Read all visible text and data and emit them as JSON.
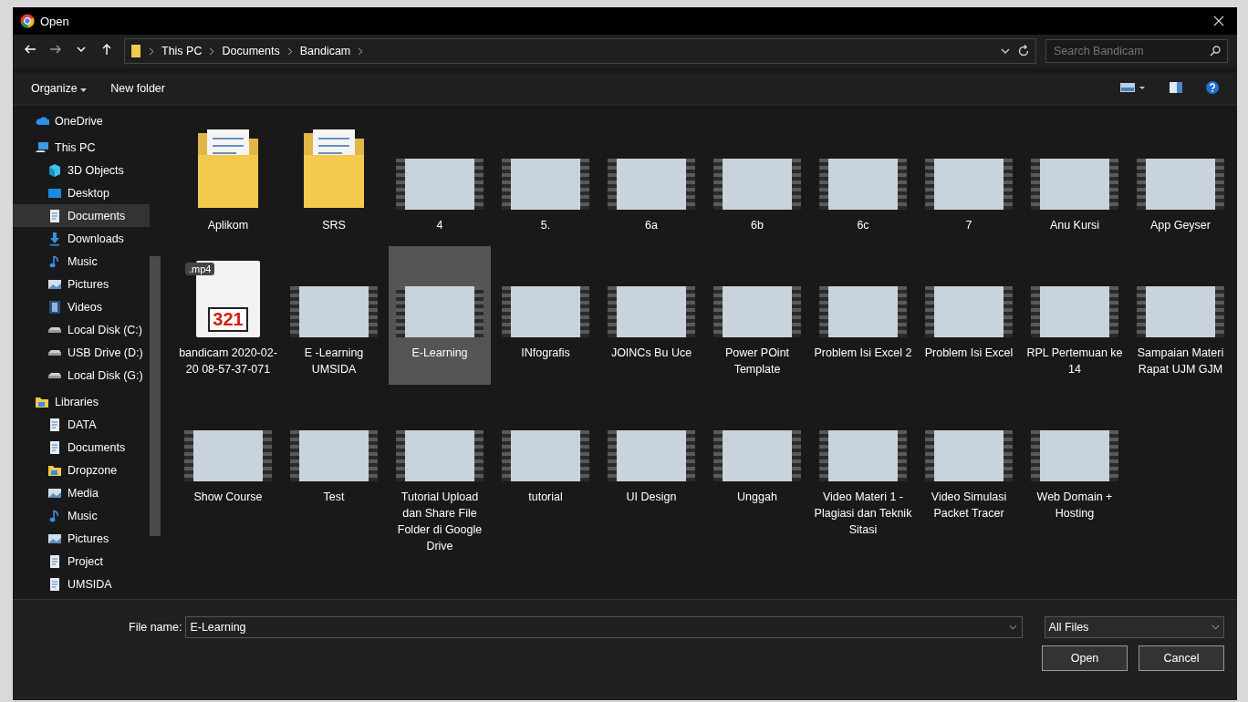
{
  "window": {
    "title": "Open"
  },
  "address": {
    "path": [
      "This PC",
      "Documents",
      "Bandicam"
    ],
    "search_placeholder": "Search Bandicam"
  },
  "toolbar": {
    "organize": "Organize",
    "new_folder": "New folder"
  },
  "sidebar": {
    "items": [
      {
        "label": "OneDrive",
        "selected": false
      },
      {
        "label": "This PC",
        "selected": false,
        "children": [
          {
            "label": "3D Objects",
            "selected": false
          },
          {
            "label": "Desktop",
            "selected": false
          },
          {
            "label": "Documents",
            "selected": true
          },
          {
            "label": "Downloads",
            "selected": false
          },
          {
            "label": "Music",
            "selected": false
          },
          {
            "label": "Pictures",
            "selected": false
          },
          {
            "label": "Videos",
            "selected": false
          },
          {
            "label": "Local Disk (C:)",
            "selected": false
          },
          {
            "label": "USB Drive (D:)",
            "selected": false
          },
          {
            "label": "Local Disk (G:)",
            "selected": false
          }
        ]
      },
      {
        "label": "Libraries",
        "selected": false,
        "children": [
          {
            "label": "DATA",
            "selected": false
          },
          {
            "label": "Documents",
            "selected": false
          },
          {
            "label": "Dropzone",
            "selected": false
          },
          {
            "label": "Media",
            "selected": false
          },
          {
            "label": "Music",
            "selected": false
          },
          {
            "label": "Pictures",
            "selected": false
          },
          {
            "label": "Project",
            "selected": false
          },
          {
            "label": "UMSIDA",
            "selected": false
          }
        ]
      }
    ]
  },
  "files": [
    {
      "name": "Aplikom",
      "kind": "folder",
      "selected": false
    },
    {
      "name": "SRS",
      "kind": "folder",
      "selected": false
    },
    {
      "name": "4",
      "kind": "video",
      "selected": false
    },
    {
      "name": "5.",
      "kind": "video",
      "selected": false
    },
    {
      "name": "6a",
      "kind": "video",
      "selected": false
    },
    {
      "name": "6b",
      "kind": "video",
      "selected": false
    },
    {
      "name": "6c",
      "kind": "video",
      "selected": false
    },
    {
      "name": "7",
      "kind": "video",
      "selected": false
    },
    {
      "name": "Anu Kursi",
      "kind": "video",
      "selected": false
    },
    {
      "name": "App Geyser",
      "kind": "video",
      "selected": false
    },
    {
      "name": "bandicam 2020-02-20 08-57-37-071",
      "kind": "mp4",
      "badge": ".mp4",
      "icon_text": "321",
      "selected": false
    },
    {
      "name": "E -Learning UMSIDA",
      "kind": "video",
      "selected": false
    },
    {
      "name": "E-Learning",
      "kind": "video",
      "selected": true
    },
    {
      "name": "INfografis",
      "kind": "video",
      "selected": false
    },
    {
      "name": "JOINCs Bu Uce",
      "kind": "video",
      "selected": false
    },
    {
      "name": "Power POint Template",
      "kind": "video",
      "selected": false
    },
    {
      "name": "Problem Isi Excel 2",
      "kind": "video",
      "selected": false
    },
    {
      "name": "Problem Isi Excel",
      "kind": "video",
      "selected": false
    },
    {
      "name": "RPL Pertemuan ke 14",
      "kind": "video",
      "selected": false
    },
    {
      "name": "Sampaian Materi Rapat UJM GJM",
      "kind": "video",
      "selected": false
    },
    {
      "name": "Show Course",
      "kind": "video",
      "selected": false
    },
    {
      "name": "Test",
      "kind": "video",
      "selected": false
    },
    {
      "name": "Tutorial Upload dan Share File Folder di Google Drive",
      "kind": "video",
      "selected": false
    },
    {
      "name": "tutorial",
      "kind": "video",
      "selected": false
    },
    {
      "name": "UI Design",
      "kind": "video",
      "selected": false
    },
    {
      "name": "Unggah",
      "kind": "video",
      "selected": false
    },
    {
      "name": "Video Materi 1 - Plagiasi dan Teknik Sitasi",
      "kind": "video",
      "selected": false
    },
    {
      "name": "Video Simulasi Packet Tracer",
      "kind": "video",
      "selected": false
    },
    {
      "name": "Web Domain + Hosting",
      "kind": "video",
      "selected": false
    }
  ],
  "bottom": {
    "file_name_label": "File name:",
    "file_name": "E-Learning",
    "filter": "All Files",
    "buttons": [
      "Open",
      "Cancel"
    ]
  }
}
